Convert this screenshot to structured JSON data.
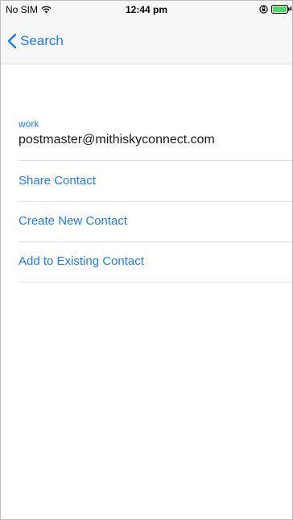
{
  "status_bar": {
    "carrier": "No SIM",
    "time": "12:44 pm",
    "icons": [
      "wifi-icon",
      "lock-icon",
      "battery-icon"
    ]
  },
  "nav": {
    "back_label": "Search",
    "back_icon": "chevron-left-icon"
  },
  "contact": {
    "email_type": "work",
    "email": "postmaster@mithiskyconnect.com"
  },
  "actions": [
    {
      "label": "Share Contact"
    },
    {
      "label": "Create New Contact"
    },
    {
      "label": "Add to Existing Contact"
    }
  ],
  "colors": {
    "accent": "#1a7ef5",
    "bar_background": "#f7f7f8",
    "separator": "#dedede",
    "battery": "#4cd964"
  }
}
